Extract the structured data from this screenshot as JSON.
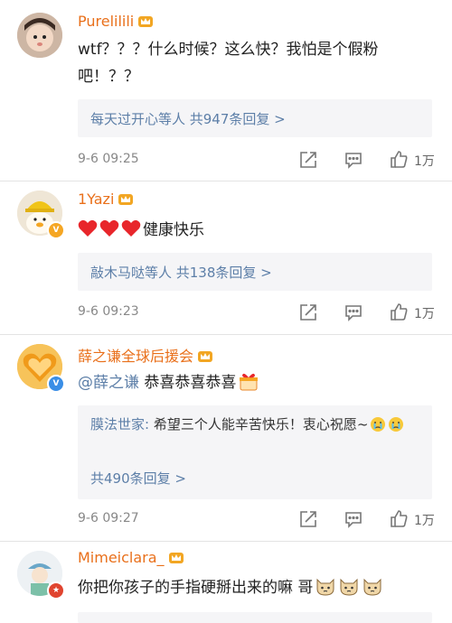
{
  "comments": [
    {
      "username": "Purelilili",
      "text": "wtf？？？什么时候？这么快？我怕是个假粉吧！？？",
      "replies_summary": "每天过开心等人 共947条回复 >",
      "time": "9-6 09:25",
      "likes": "1万"
    },
    {
      "username": "1Yazi",
      "text": "健康快乐",
      "replies_summary": "敲木马哒等人 共138条回复 >",
      "time": "9-6 09:23",
      "likes": "1万"
    },
    {
      "username": "薛之谦全球后援会",
      "mention": "@薛之谦",
      "text": "恭喜恭喜恭喜",
      "reply_author": "膜法世家:",
      "reply_text": "希望三个人能辛苦快乐！衷心祝愿~",
      "replies_summary": "共490条回复 >",
      "time": "9-6 09:27",
      "likes": "1万"
    },
    {
      "username": "Mimeiclara_",
      "text": "你把你孩子的手指硬掰出来的嘛 哥"
    }
  ],
  "icons": {
    "share": "share-icon",
    "comment": "comment-icon",
    "like": "thumbs-up-icon",
    "crown": "crown-icon",
    "heart": "heart-icon"
  },
  "colors": {
    "username": "#e9701b",
    "link": "#5d7fa8",
    "reply_bg": "#f5f5f7",
    "meta": "#888888",
    "verified_gold": "#f5a623",
    "verified_blue": "#3a8ee6",
    "verified_red": "#e0442f"
  }
}
